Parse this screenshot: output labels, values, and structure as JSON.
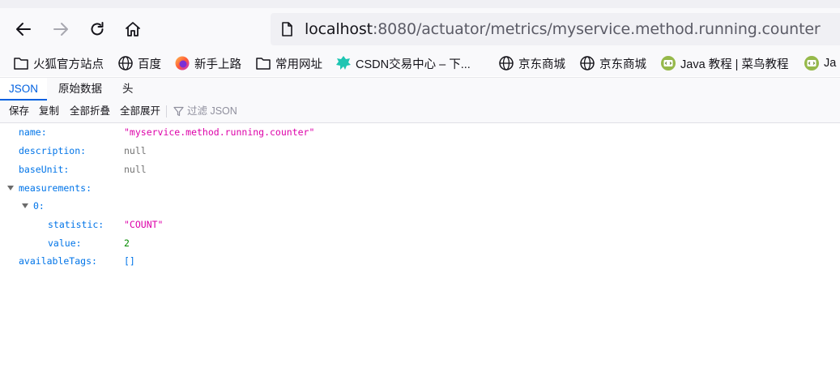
{
  "browser": {
    "url_host": "localhost",
    "url_rest": ":8080/actuator/metrics/myservice.method.running.counter",
    "nav": {
      "back_icon": "back-arrow-icon",
      "forward_icon": "forward-arrow-icon",
      "reload_icon": "reload-icon",
      "home_icon": "home-icon"
    }
  },
  "bookmarks": [
    {
      "label": "火狐官方站点",
      "icon": "folder-icon"
    },
    {
      "label": "百度",
      "icon": "globe-icon"
    },
    {
      "label": "新手上路",
      "icon": "firefox-icon"
    },
    {
      "label": "常用网址",
      "icon": "folder-icon"
    },
    {
      "label": "CSDN交易中心 – 下...",
      "icon": "csdn-icon"
    },
    {
      "label": "京东商城",
      "icon": "globe-icon"
    },
    {
      "label": "京东商城",
      "icon": "globe-icon"
    },
    {
      "label": "Java 教程 | 菜鸟教程",
      "icon": "runoob-icon"
    },
    {
      "label": "Ja",
      "icon": "runoob-icon"
    }
  ],
  "viewer": {
    "tabs": [
      "JSON",
      "原始数据",
      "头"
    ],
    "active_tab": "JSON",
    "toolbar": {
      "save": "保存",
      "copy": "复制",
      "collapse_all": "全部折叠",
      "expand_all": "全部展开",
      "filter_placeholder": "过滤 JSON"
    }
  },
  "json": {
    "name_key": "name:",
    "name_val": "\"myservice.method.running.counter\"",
    "description_key": "description:",
    "description_val": "null",
    "baseUnit_key": "baseUnit:",
    "baseUnit_val": "null",
    "measurements_key": "measurements:",
    "index_key": "0:",
    "statistic_key": "statistic:",
    "statistic_val": "\"COUNT\"",
    "value_key": "value:",
    "value_val": "2",
    "availableTags_key": "availableTags:",
    "availableTags_val": "[]"
  },
  "colors": {
    "accent": "#0061e0",
    "json_key": "#0074e8",
    "json_string": "#dd00a9",
    "json_number": "#058b00",
    "json_null": "#737373"
  }
}
